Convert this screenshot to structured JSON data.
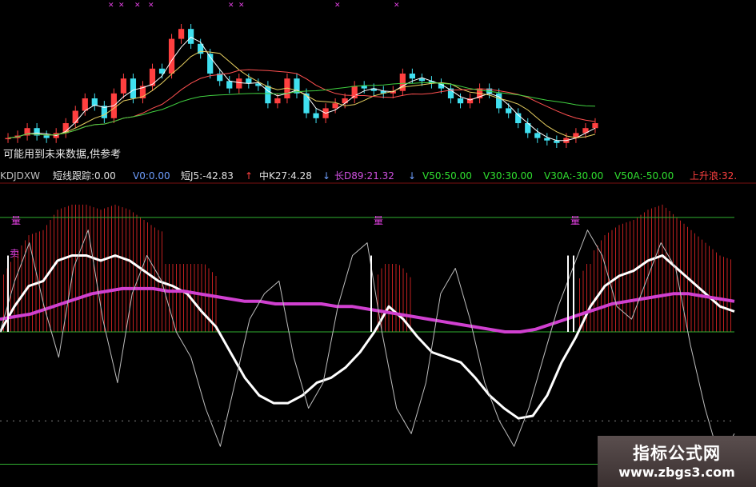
{
  "header": {
    "indicator": "KDJDXW",
    "short_track": "短线跟踪:0.00",
    "v0": "V0:0.00",
    "j5": "短J5:-42.83",
    "k27": "中K27:4.28",
    "d89": "长D89:21.32",
    "v50": "V50:50.00",
    "v30": "V30:30.00",
    "v30a": "V30A:-30.00",
    "v50a": "V50A:-50.00",
    "rising": "上升浪:32."
  },
  "note": "可能用到未来数据,供参考",
  "markers": {
    "buy": "量",
    "sell": "卖"
  },
  "watermark": {
    "line1": "指标公式网",
    "line2": "www.zbgs3.com"
  },
  "chart_data": [
    {
      "type": "candlestick",
      "moving_averages": [
        "white",
        "yellow",
        "red",
        "green"
      ],
      "candles_close": [
        4,
        5,
        8,
        5,
        4,
        6,
        10,
        15,
        20,
        17,
        12,
        22,
        28,
        20,
        25,
        32,
        30,
        44,
        48,
        42,
        38,
        30,
        27,
        24,
        28,
        26,
        25,
        18,
        20,
        28,
        22,
        14,
        12,
        16,
        18,
        20,
        25,
        24,
        23,
        22,
        23,
        30,
        28,
        27,
        26,
        24,
        20,
        18,
        20,
        24,
        22,
        16,
        14,
        10,
        6,
        4,
        3,
        2,
        4,
        6,
        8,
        10
      ]
    },
    {
      "type": "line",
      "reference_lines": [
        50,
        30,
        -30,
        -50
      ],
      "ylim": [
        -55,
        55
      ],
      "series": [
        {
          "color": "white-thick",
          "values": [
            0,
            10,
            18,
            20,
            28,
            30,
            30,
            28,
            30,
            28,
            24,
            20,
            18,
            15,
            8,
            2,
            -8,
            -18,
            -25,
            -28,
            -28,
            -25,
            -20,
            -18,
            -14,
            -8,
            0,
            10,
            5,
            -2,
            -8,
            -10,
            -12,
            -18,
            -25,
            -30,
            -34,
            -33,
            -25,
            -12,
            -2,
            10,
            18,
            22,
            24,
            28,
            30,
            25,
            20,
            15,
            10,
            8
          ]
        },
        {
          "color": "magenta",
          "values": [
            5,
            6,
            7,
            9,
            11,
            13,
            15,
            16,
            17,
            17,
            17,
            16,
            16,
            15,
            14,
            13,
            12,
            12,
            11,
            11,
            11,
            11,
            10,
            10,
            9,
            8,
            7,
            6,
            5,
            4,
            3,
            2,
            1,
            0,
            0,
            1,
            3,
            5,
            7,
            9,
            11,
            12,
            13,
            14,
            15,
            15,
            14,
            13,
            12
          ]
        },
        {
          "color": "grey-thin",
          "values": [
            0,
            20,
            35,
            10,
            -10,
            25,
            40,
            5,
            -20,
            15,
            30,
            20,
            0,
            -10,
            -30,
            -45,
            -20,
            5,
            15,
            20,
            -10,
            -30,
            -20,
            10,
            30,
            35,
            0,
            -30,
            -40,
            -20,
            15,
            25,
            5,
            -20,
            -35,
            -45,
            -30,
            -10,
            10,
            25,
            40,
            30,
            10,
            5,
            20,
            35,
            25,
            -5,
            -30,
            -50,
            -40
          ]
        }
      ]
    }
  ]
}
